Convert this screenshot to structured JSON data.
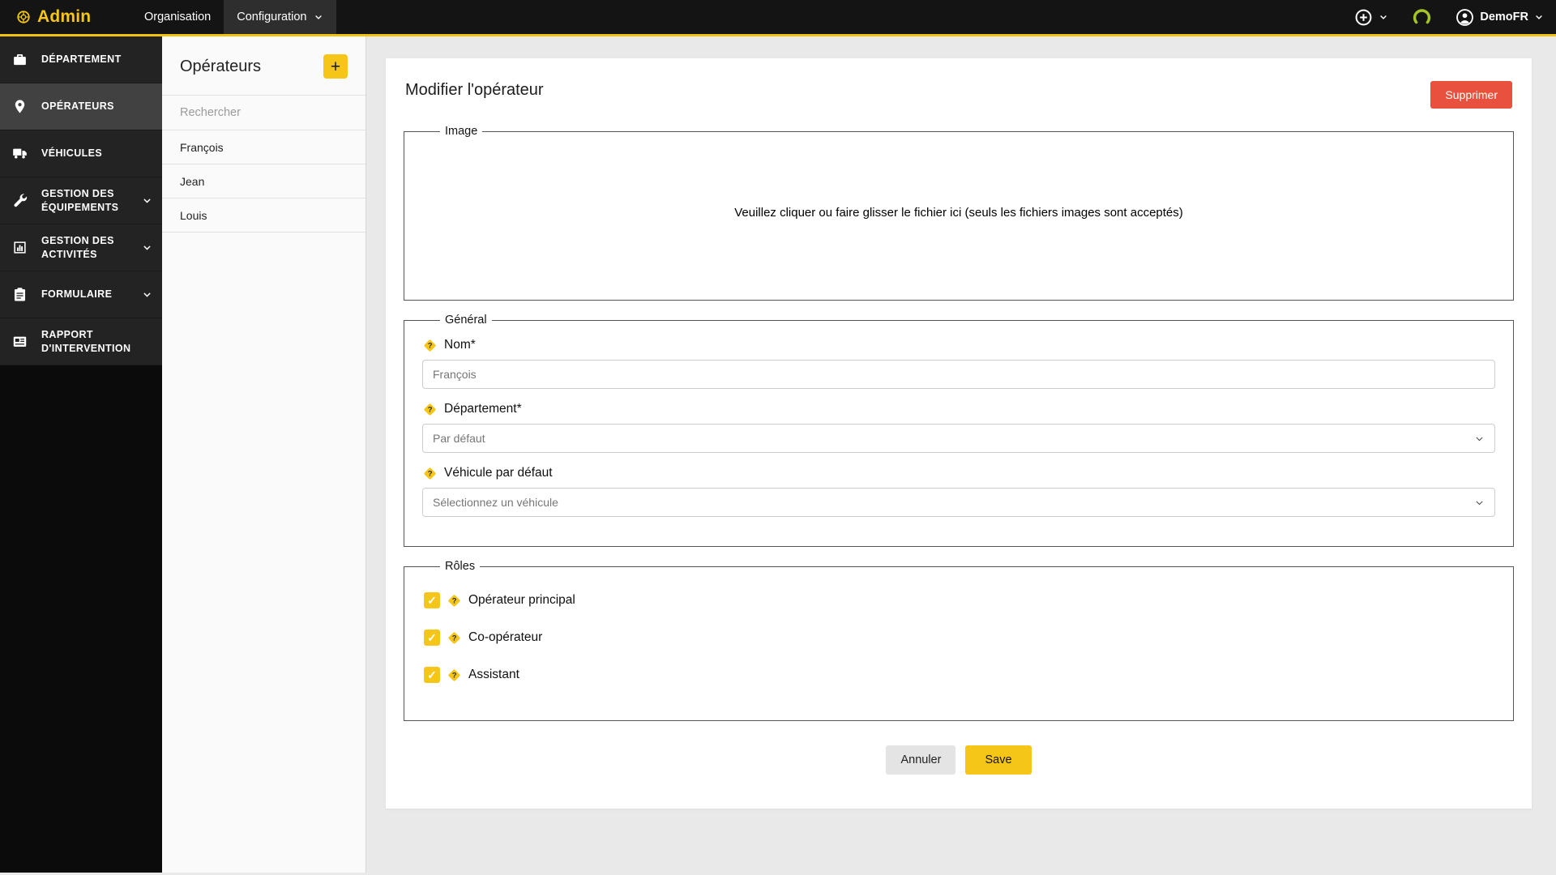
{
  "colors": {
    "accent": "#f5c518",
    "topbar_line": "#f2c114",
    "danger": "#e8513d",
    "sidebar_bg": "#232323",
    "sidebar_active_bg": "#414141"
  },
  "topbar": {
    "logo_text": "Admin",
    "menu": [
      {
        "label": "Organisation"
      },
      {
        "label": "Configuration"
      }
    ],
    "icons": [
      "plus-circle",
      "chevron-down",
      "gauge-arc",
      "user-circle"
    ],
    "user_label": "DemoFR"
  },
  "sidebar": {
    "items": [
      {
        "label": "Département",
        "icon": "briefcase",
        "active": false,
        "expandable": false
      },
      {
        "label": "Opérateurs",
        "icon": "map-pin",
        "active": true,
        "expandable": false
      },
      {
        "label": "Véhicules",
        "icon": "truck",
        "active": false,
        "expandable": false
      },
      {
        "label": "Gestion des équipements",
        "icon": "wrench",
        "active": false,
        "expandable": true
      },
      {
        "label": "Gestion des activités",
        "icon": "bar-chart",
        "active": false,
        "expandable": true
      },
      {
        "label": "Formulaire",
        "icon": "clipboard",
        "active": false,
        "expandable": true
      },
      {
        "label": "Rapport d'intervention",
        "icon": "report",
        "active": false,
        "expandable": false
      }
    ]
  },
  "panel": {
    "title": "Opérateurs",
    "add_label": "+",
    "search_placeholder": "Rechercher",
    "items": [
      "François",
      "Jean",
      "Louis"
    ]
  },
  "main": {
    "title": "Modifier l'opérateur",
    "delete_label": "Supprimer",
    "image": {
      "legend": "Image",
      "dropzone_text": "Veuillez cliquer ou faire glisser le fichier ici (seuls les fichiers images sont acceptés)"
    },
    "general": {
      "legend": "Général",
      "fields": [
        {
          "label": "Nom*",
          "type": "input",
          "value": "François"
        },
        {
          "label": "Département*",
          "type": "select",
          "value": "Par défaut"
        },
        {
          "label": "Véhicule par défaut",
          "type": "select",
          "value": "Sélectionnez un véhicule"
        }
      ]
    },
    "roles": {
      "legend": "Rôles",
      "items": [
        {
          "label": "Opérateur principal",
          "checked": true
        },
        {
          "label": "Co-opérateur",
          "checked": true
        },
        {
          "label": "Assistant",
          "checked": true
        }
      ]
    },
    "cancel_label": "Annuler",
    "save_label": "Save"
  }
}
